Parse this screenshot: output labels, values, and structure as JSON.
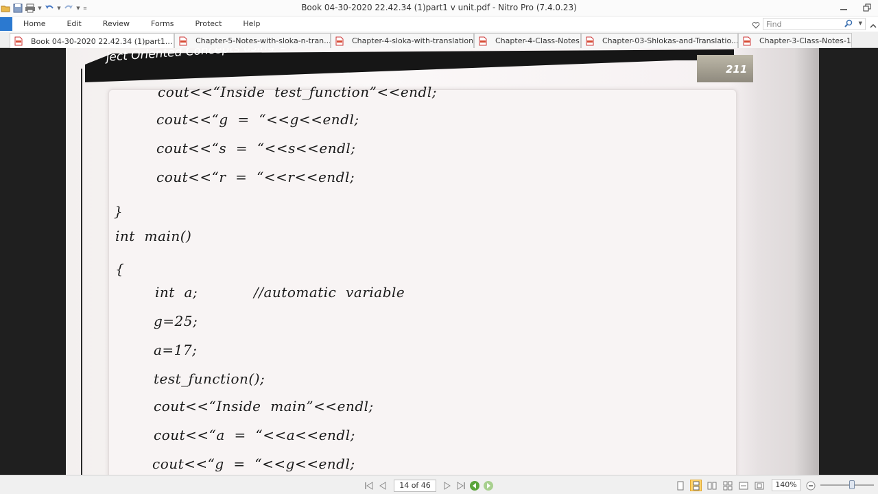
{
  "window": {
    "title": "Book 04-30-2020 22.42.34 (1)part1 v unit.pdf - Nitro Pro (7.4.0.23)"
  },
  "menu": [
    "Home",
    "Edit",
    "Review",
    "Forms",
    "Protect",
    "Help"
  ],
  "find": {
    "placeholder": "Find"
  },
  "tabs": [
    {
      "label": "Book 04-30-2020 22.42.34 (1)part1..."
    },
    {
      "label": "Chapter-5-Notes-with-sloka-n-tran..."
    },
    {
      "label": "Chapter-4-sloka-with-translation"
    },
    {
      "label": "Chapter-4-Class-Notes"
    },
    {
      "label": "Chapter-03-Shlokas-and-Translatio..."
    },
    {
      "label": "Chapter-3-Class-Notes-1"
    }
  ],
  "document": {
    "header_title": "ject Oriented Concepts using C++",
    "page_number": "211",
    "code_lines": [
      "cout<<“Inside  test_function”<<endl;",
      "cout<<“g  =  “<<g<<endl;",
      "cout<<“s  =  “<<s<<endl;",
      "cout<<“r  =  “<<r<<endl;",
      "}",
      "int  main()",
      "{",
      "int  a;",
      "//automatic  variable",
      "g=25;",
      "a=17;",
      "test_function();",
      "cout<<“Inside  main”<<endl;",
      "cout<<“a  =  “<<a<<endl;",
      "cout<<“g  =  “<<g<<endl;"
    ]
  },
  "status": {
    "page_indicator": "14 of 46",
    "zoom": "140%"
  }
}
